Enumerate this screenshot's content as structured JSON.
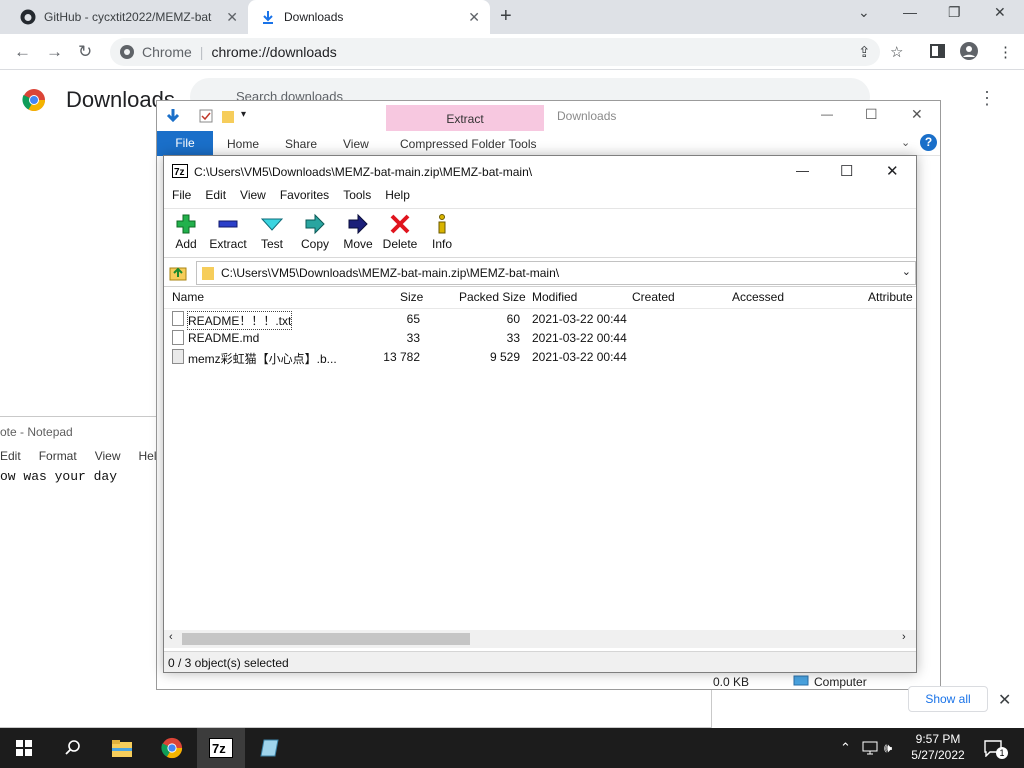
{
  "browser": {
    "tabs": [
      {
        "title": "GitHub - cycxtit2022/MEMZ-bat",
        "active": false
      },
      {
        "title": "Downloads",
        "active": true
      }
    ],
    "new_tab": "+",
    "omnibox": {
      "site_label": "Chrome",
      "url": "chrome://downloads"
    },
    "window_controls": {
      "minimize": "—",
      "maximize": "❐",
      "close": "✕",
      "tab_search": "⌄"
    }
  },
  "downloads_page": {
    "title": "Downloads",
    "search_placeholder": "Search downloads",
    "menu": "⋮",
    "show_all": "Show all",
    "close_shelf": "✕"
  },
  "notepad": {
    "title": "ote - Notepad",
    "menu": [
      "Edit",
      "Format",
      "View",
      "Help"
    ],
    "text": "ow was your day"
  },
  "explorer": {
    "contextual_tab": "Extract",
    "title": "Downloads",
    "ribbon_tabs": [
      "File",
      "Home",
      "Share",
      "View",
      "Compressed Folder Tools"
    ],
    "help": "?",
    "status_size": "0.0 KB",
    "status_location": "Computer"
  },
  "sevenzip": {
    "title": "C:\\Users\\VM5\\Downloads\\MEMZ-bat-main.zip\\MEMZ-bat-main\\",
    "menu": [
      "File",
      "Edit",
      "View",
      "Favorites",
      "Tools",
      "Help"
    ],
    "toolbar": [
      "Add",
      "Extract",
      "Test",
      "Copy",
      "Move",
      "Delete",
      "Info"
    ],
    "address": "C:\\Users\\VM5\\Downloads\\MEMZ-bat-main.zip\\MEMZ-bat-main\\",
    "columns": [
      "Name",
      "Size",
      "Packed Size",
      "Modified",
      "Created",
      "Accessed",
      "Attribute"
    ],
    "files": [
      {
        "name": "README！！！.txt",
        "size": "65",
        "packed": "60",
        "modified": "2021-03-22 00:44"
      },
      {
        "name": "README.md",
        "size": "33",
        "packed": "33",
        "modified": "2021-03-22 00:44"
      },
      {
        "name": "memz彩虹猫【小心点】.b...",
        "size": "13 782",
        "packed": "9 529",
        "modified": "2021-03-22 00:44"
      }
    ],
    "status": "0 / 3 object(s) selected",
    "window_controls": {
      "minimize": "—",
      "maximize": "☐",
      "close": "✕"
    }
  },
  "taskbar": {
    "time": "9:57 PM",
    "date": "5/27/2022",
    "notification_count": "1"
  },
  "colors": {
    "chrome_tabstrip": "#dee1e6",
    "explorer_file_tab": "#1a6fc9",
    "extract_highlight": "#f7c8e0",
    "taskbar": "#1c1c1c"
  }
}
